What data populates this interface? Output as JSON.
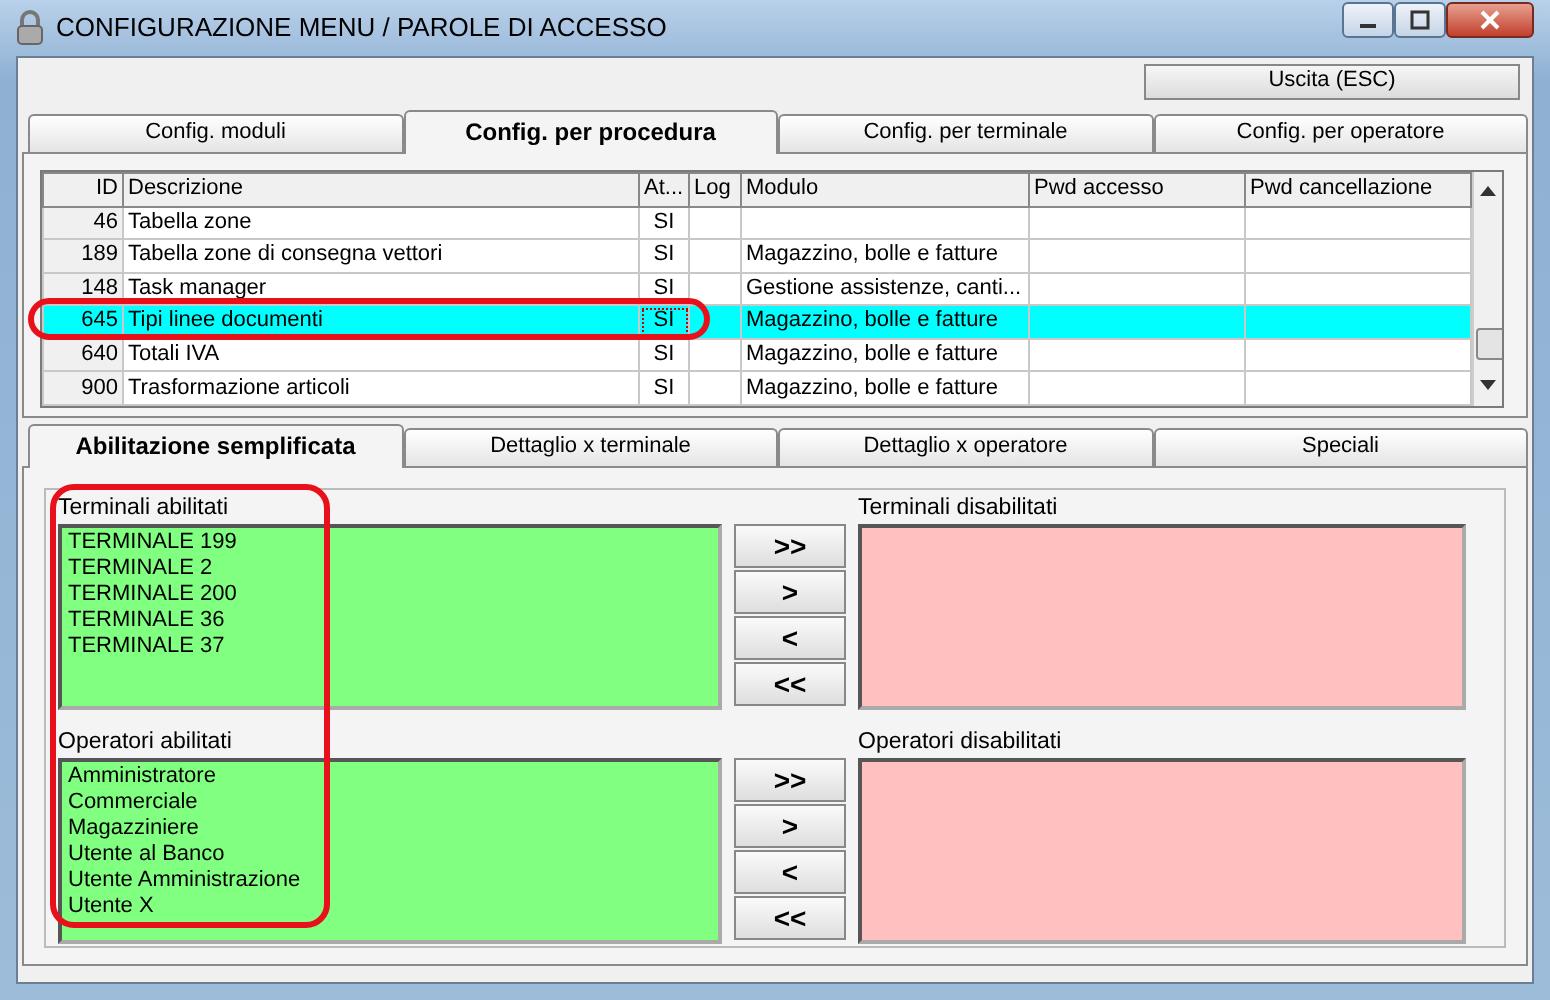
{
  "window": {
    "title": "CONFIGURAZIONE MENU / PAROLE DI ACCESSO"
  },
  "exit_button": "Uscita (ESC)",
  "tabs": [
    {
      "label": "Config. moduli",
      "selected": false
    },
    {
      "label": "Config. per procedura",
      "selected": true
    },
    {
      "label": "Config. per terminale",
      "selected": false
    },
    {
      "label": "Config. per operatore",
      "selected": false
    }
  ],
  "table": {
    "columns": [
      "ID",
      "Descrizione",
      "At...",
      "Log",
      "Modulo",
      "Pwd accesso",
      "Pwd cancellazione"
    ],
    "rows": [
      {
        "id": "46",
        "description": "Tabella zone",
        "active": "SI",
        "module": "",
        "selected": false,
        "circled": false
      },
      {
        "id": "189",
        "description": "Tabella zone di consegna vettori",
        "active": "SI",
        "module": "Magazzino, bolle e fatture",
        "selected": false,
        "circled": false
      },
      {
        "id": "148",
        "description": "Task manager",
        "active": "SI",
        "module": "Gestione assistenze, canti...",
        "selected": false,
        "circled": false
      },
      {
        "id": "645",
        "description": "Tipi linee documenti",
        "active": "SI",
        "module": "Magazzino, bolle e fatture",
        "selected": true,
        "circled": true
      },
      {
        "id": "640",
        "description": "Totali IVA",
        "active": "SI",
        "module": "Magazzino, bolle e fatture",
        "selected": false,
        "circled": false
      },
      {
        "id": "900",
        "description": "Trasformazione articoli",
        "active": "SI",
        "module": "Magazzino, bolle e fatture",
        "selected": false,
        "circled": false
      }
    ]
  },
  "subtabs": [
    {
      "label": "Abilitazione semplificata",
      "selected": true
    },
    {
      "label": "Dettaglio x terminale",
      "selected": false
    },
    {
      "label": "Dettaglio x operatore",
      "selected": false
    },
    {
      "label": "Speciali",
      "selected": false
    }
  ],
  "enabled_lists_circled": true,
  "sections": [
    {
      "enabled_label": "Terminali abilitati",
      "enabled_items": [
        "TERMINALE 199",
        "TERMINALE 2",
        "TERMINALE 200",
        "TERMINALE 36",
        "TERMINALE 37"
      ],
      "disabled_label": "Terminali disabilitati",
      "buttons": [
        ">>",
        ">",
        "<",
        "<<"
      ]
    },
    {
      "enabled_label": "Operatori abilitati",
      "enabled_items": [
        "Amministratore",
        "Commerciale",
        "Magazziniere",
        "Utente al Banco",
        "Utente Amministrazione",
        "Utente X"
      ],
      "disabled_label": "Operatori disabilitati",
      "buttons": [
        ">>",
        ">",
        "<",
        "<<"
      ]
    }
  ]
}
